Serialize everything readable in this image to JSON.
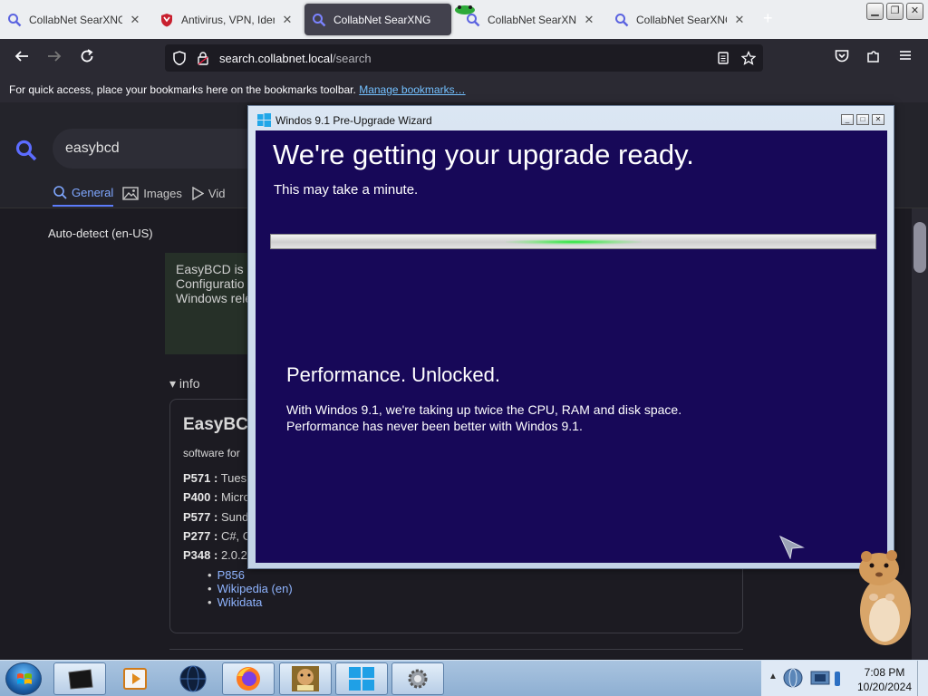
{
  "browser": {
    "tabs": [
      {
        "title": "CollabNet SearXNG",
        "active": false
      },
      {
        "title": "Antivirus, VPN, Identi",
        "active": false
      },
      {
        "title": "CollabNet SearXNG",
        "active": true
      },
      {
        "title": "CollabNet SearXNG",
        "active": false
      },
      {
        "title": "CollabNet SearXNG",
        "active": false
      }
    ],
    "new_tab_symbol": "+",
    "url_host": "search.collabnet.local",
    "url_path": "/search",
    "bookmarks_message": "For quick access, place your bookmarks here on the bookmarks toolbar.",
    "manage_bookmarks": "Manage bookmarks…"
  },
  "search": {
    "query": "easybcd",
    "categories": [
      {
        "label": "General",
        "active": true
      },
      {
        "label": "Images",
        "active": false
      },
      {
        "label": "Vid",
        "active": false
      }
    ],
    "language": "Auto-detect (en-US)"
  },
  "answer_box": {
    "lines": [
      "EasyBCD is",
      "Configuratio",
      "Windows rele"
    ]
  },
  "info_section": {
    "header": "▾ info",
    "title": "EasyBC",
    "subtitle": "software for",
    "properties": [
      {
        "key": "P571 :",
        "value": "Tues"
      },
      {
        "key": "P400 :",
        "value": "Micro"
      },
      {
        "key": "P577 :",
        "value": "Sund"
      },
      {
        "key": "P277 :",
        "value": "C#, C"
      },
      {
        "key": "P348 :",
        "value": "2.0.2"
      }
    ],
    "links": [
      "P856",
      "Wikipedia (en)",
      "Wikidata"
    ]
  },
  "wizard": {
    "window_title": "Windos 9.1 Pre-Upgrade Wizard",
    "heading": "We're getting your upgrade ready.",
    "subheading": "This may take a minute.",
    "progress_fraction": 0.5,
    "section_heading": "Performance. Unlocked.",
    "paragraph_line1": "With Windos 9.1, we're taking up twice the CPU, RAM and disk space.",
    "paragraph_line2": "Performance has never been better with Windos 9.1."
  },
  "taskbar": {
    "buttons": [
      "terminal-icon",
      "media-player-icon",
      "globe-icon",
      "firefox-icon",
      "game-box-icon",
      "windows-logo-icon",
      "settings-gear-icon"
    ],
    "clock_time": "7:08 PM",
    "clock_date": "10/20/2024"
  },
  "colors": {
    "wizard_background": "#170858",
    "browser_chrome": "#2b2a33",
    "active_category": "#7fa7ff",
    "link": "#8fb4ff"
  }
}
